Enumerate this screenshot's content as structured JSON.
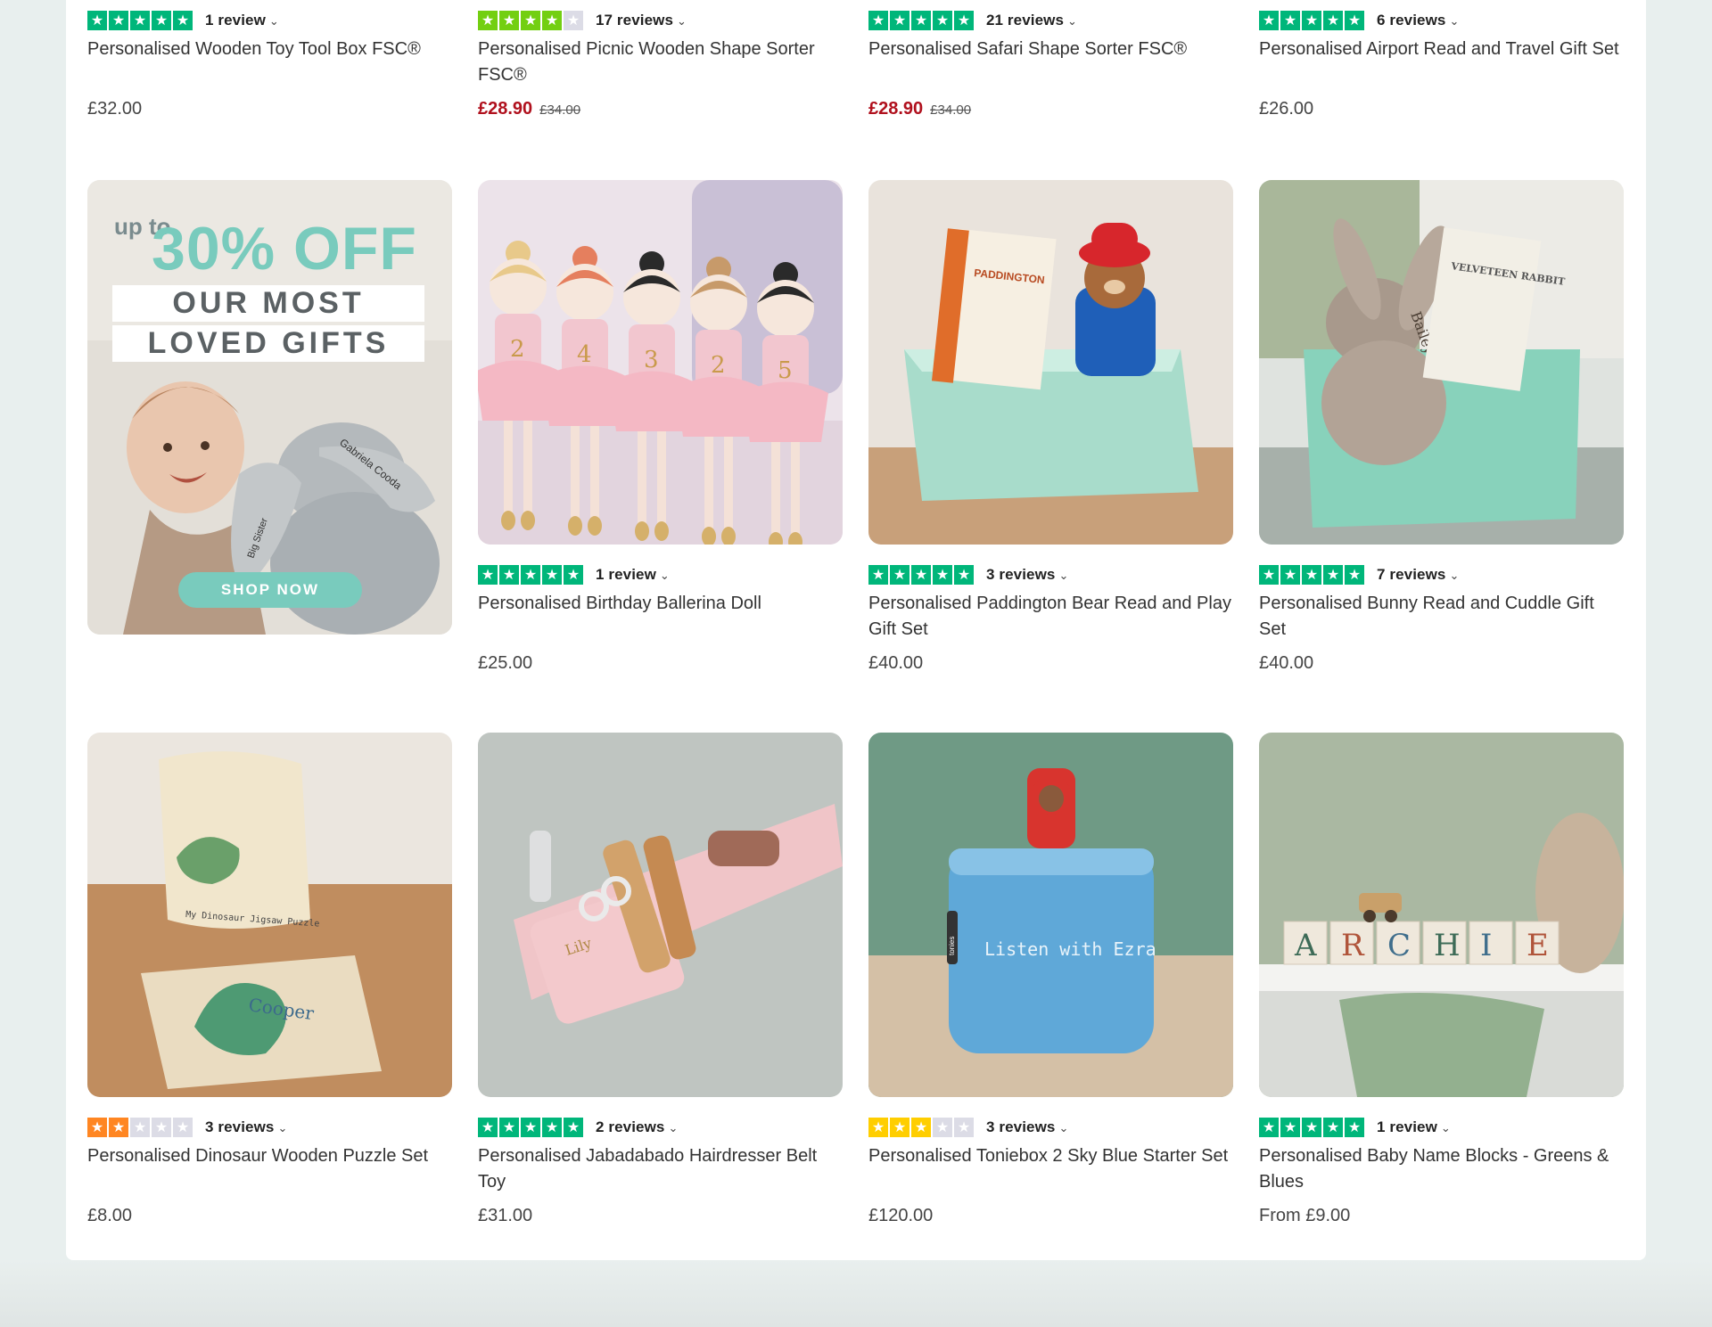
{
  "colors": {
    "star_green": "#00b67a",
    "star_lightgreen": "#73cf11",
    "star_yellow": "#ffce00",
    "star_orange": "#ff8622",
    "star_empty": "#dcdce6",
    "sale_red": "#b0101d",
    "accent_teal": "#79cbbd"
  },
  "promo": {
    "up_to": "up to",
    "headline": "30% OFF",
    "line1": "OUR MOST",
    "line2": "LOVED GIFTS",
    "cta": "SHOP NOW",
    "image_text_ribbon1": "Big Sister",
    "image_text_ribbon2": "Gabriela Cooda"
  },
  "products": [
    {
      "name": "Personalised Wooden Toy Tool Box FSC®",
      "rating": 5,
      "reviews": "1 review",
      "price": "£32.00",
      "was": ""
    },
    {
      "name": "Personalised Picnic Wooden Shape Sorter FSC®",
      "rating": 4,
      "reviews": "17 reviews",
      "price": "£28.90",
      "was": "£34.00"
    },
    {
      "name": "Personalised Safari Shape Sorter FSC®",
      "rating": 5,
      "reviews": "21 reviews",
      "price": "£28.90",
      "was": "£34.00"
    },
    {
      "name": "Personalised Airport Read and Travel Gift Set",
      "rating": 5,
      "reviews": "6 reviews",
      "price": "£26.00",
      "was": ""
    },
    {
      "name": "Personalised Birthday Ballerina Doll",
      "rating": 5,
      "reviews": "1 review",
      "price": "£25.00",
      "was": ""
    },
    {
      "name": "Personalised Paddington Bear Read and Play Gift Set",
      "rating": 5,
      "reviews": "3 reviews",
      "price": "£40.00",
      "was": ""
    },
    {
      "name": "Personalised Bunny Read and Cuddle Gift Set",
      "rating": 5,
      "reviews": "7 reviews",
      "price": "£40.00",
      "was": ""
    },
    {
      "name": "Personalised Dinosaur Wooden Puzzle Set",
      "rating": 2,
      "reviews": "3 reviews",
      "price": "£8.00",
      "was": ""
    },
    {
      "name": "Personalised Jabadabado Hairdresser Belt Toy",
      "rating": 5,
      "reviews": "2 reviews",
      "price": "£31.00",
      "was": ""
    },
    {
      "name": "Personalised Toniebox 2 Sky Blue Starter Set",
      "rating": 3,
      "reviews": "3 reviews",
      "price": "£120.00",
      "was": ""
    },
    {
      "name": "Personalised Baby Name Blocks - Greens & Blues",
      "rating": 5,
      "reviews": "1 review",
      "price": "From £9.00",
      "was": ""
    }
  ],
  "image_text": {
    "paddington_book": "PADDINGTON",
    "bunny_book": "VELVETEEN RABBIT",
    "bunny_name": "Bailey",
    "puzzle_bag": "My Dinosaur Jigsaw Puzzle",
    "puzzle_name": "Cooper",
    "belt_name": "Lily",
    "tonie_text": "Listen with Ezra",
    "tonie_brand": "tonies",
    "blocks": [
      "A",
      "R",
      "C",
      "H",
      "I",
      "E"
    ],
    "ballerina_numbers": [
      "2",
      "4",
      "3",
      "2",
      "5"
    ]
  }
}
